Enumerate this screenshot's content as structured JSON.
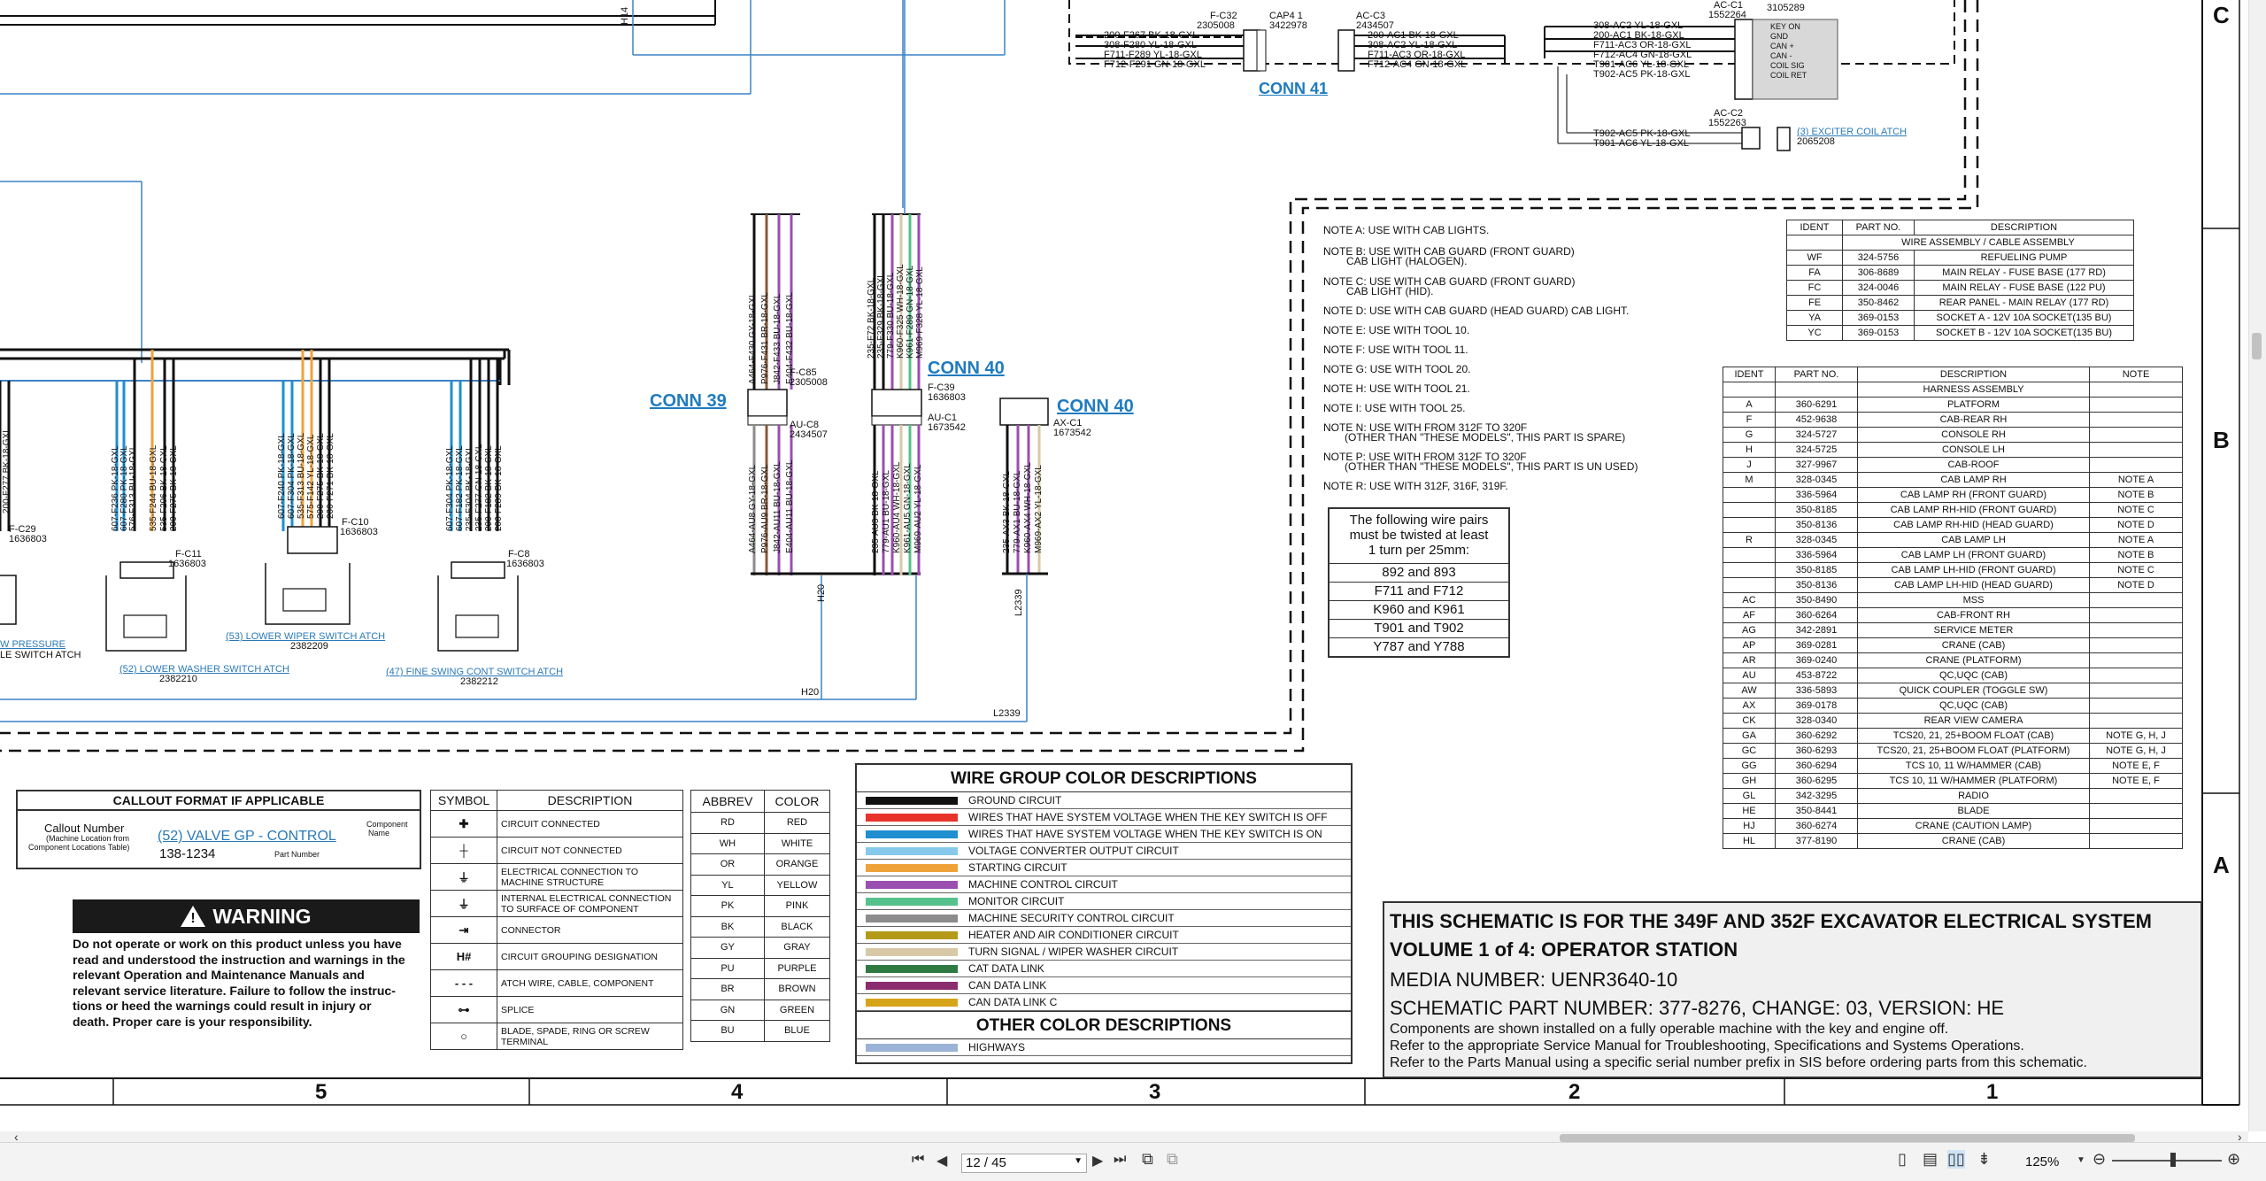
{
  "schematic": {
    "zone_labels": {
      "c": "C",
      "b": "B",
      "a": "A"
    },
    "grid_numbers": [
      "5",
      "4",
      "3",
      "2",
      "1"
    ],
    "top_connectors": {
      "fc32": {
        "ref": "F-C32",
        "part": "2305008",
        "wires": [
          "200-F267 BK-18-GXL",
          "308-F280 YL-18-GXL",
          "F711-F289 YL-18-GXL",
          "F712-F291 GN-18-GXL"
        ]
      },
      "cap41": {
        "ref": "CAP4 1",
        "part": "3422978"
      },
      "acc3": {
        "ref": "AC-C3",
        "part": "2434507",
        "wires": [
          "200-AC1 BK-18-GXL",
          "308-AC2 YL-18-GXL",
          "F711-AC3 OR-18-GXL",
          "F712-AC4 GN-18-GXL"
        ]
      },
      "acc1": {
        "ref": "AC-C1",
        "part": "1552264",
        "part2": "3105289",
        "wires": [
          "308-AC2 YL-18-GXL",
          "200-AC1 BK-18-GXL",
          "F711-AC3 OR-18-GXL",
          "F712-AC4 GN-18-GXL",
          "T901-AC6 YL-18-GXL",
          "T902-AC5 PK-18-GXL"
        ],
        "pins": [
          "KEY ON",
          "GND",
          "CAN +",
          "CAN -",
          "COIL SIG",
          "COIL RET"
        ]
      },
      "acc2": {
        "ref": "AC-C2",
        "part": "1552263",
        "wires": [
          "T902-AC5 PK-18-GXL",
          "T901-AC6 YL-18-GXL"
        ],
        "link": "(3) EXCITER COIL ATCH",
        "link_part": "2065208"
      },
      "conn41": "CONN 41",
      "h14": "H14"
    },
    "mid_connectors": {
      "conn39": "CONN 39",
      "conn40a": "CONN 40",
      "conn40b": "CONN 40",
      "fc85": {
        "ref": "F-C85",
        "part": "2305008"
      },
      "auc8": {
        "ref": "AU-C8",
        "part": "2434507"
      },
      "fc39": {
        "ref": "F-C39",
        "part": "1636803"
      },
      "auc1": {
        "ref": "AU-C1",
        "part": "1673542"
      },
      "axc1": {
        "ref": "AX-C1",
        "part": "1673542"
      },
      "h20a": "H20",
      "h20b": "H20",
      "l2339a": "L2339",
      "l2339b": "L2339",
      "c39_top_wires": [
        "A464-F430 GY-18-GXL",
        "P976-F431 BR-18-GXL",
        "J842-F433 BU-18-GXL",
        "E404-F432 BU-18-GXL"
      ],
      "c39_bot_wires": [
        "A464-AU8 GY-18-GXL",
        "P976-AU9 BR-18-GXL",
        "J842-AU11 BU-18-GXL",
        "E404-AU11 BU-18-GXL"
      ],
      "c40_top_wires": [
        "235-F72 BK-18-GXL",
        "235-F329 BK-18-GXL",
        "779-F330 BU-18-GXL",
        "K960-F325 WH-18-GXL",
        "K961-F289 GN-18-GXL",
        "M969-F328 YL-18-GXL"
      ],
      "c40_bot_wires": [
        "235-AU3 BK-18-GXL",
        "779-AU1 BU-18-GXL",
        "K960-AU4 WH-18-GXL",
        "K961-AU5 GN-18-GXL",
        "M969-AU2 YL-18-GXL"
      ],
      "c40b_wires": [
        "235-AX3 BK-18-GXL",
        "779-AX1 BU-18-GXL",
        "K960-AX4 WH-18-GXL",
        "M969-AX2 YL-18-GXL"
      ]
    },
    "left_switches": {
      "fc29": {
        "ref": "F-C29",
        "part": "1636803"
      },
      "fc11": {
        "ref": "F-C11",
        "part": "1636803"
      },
      "fc10": {
        "ref": "F-C10",
        "part": "1636803"
      },
      "fc8": {
        "ref": "F-C8",
        "part": "1636803"
      },
      "sw_pressure": "W PRESSURE",
      "sw_pressure2": "LE SWITCH ATCH",
      "sw52": {
        "label": "(52) LOWER WASHER SWITCH ATCH",
        "part": "2382210"
      },
      "sw53": {
        "label": "(53) LOWER WIPER SWITCH ATCH",
        "part": "2382209"
      },
      "sw47": {
        "label": "(47) FINE SWING CONT SWITCH ATCH",
        "part": "2382212"
      },
      "w29": "200-F277 BK-18-GXL",
      "g11": [
        "607-F236 PK-18-GXL",
        "607-F280 PK-18-GXL",
        "576-F313 BU-18-GXL",
        "535-F244 BU-18-GXL",
        "535-F296 BK-18-GXL",
        "200-F275 BK-18-GXL"
      ],
      "g10": [
        "607-F240 PK-18-GXL",
        "607-F304 PK-18-GXL",
        "535-F313 BU-18-GXL",
        "575-F142 YL-18-GXL",
        "200-F275 BK-18-GXL",
        "200-F271 BK-18-GXL"
      ],
      "g8": [
        "607-F304 PK-18-GXL",
        "607-F182 PK-18-GXL",
        "235-F304 BK-18-GXL",
        "235-F277 GN-18-GXL",
        "200-F182 BK-18-GXL",
        "200-F289 BK-18-GXL"
      ]
    },
    "notes": [
      "NOTE A: USE WITH CAB LIGHTS.",
      "NOTE B: USE WITH CAB GUARD (FRONT GUARD)",
      "CAB LIGHT (HALOGEN).",
      "NOTE C: USE WITH CAB GUARD (FRONT GUARD)",
      "CAB LIGHT (HID).",
      "NOTE D: USE WITH CAB GUARD (HEAD GUARD) CAB LIGHT.",
      "NOTE E: USE WITH TOOL 10.",
      "NOTE F: USE WITH TOOL 11.",
      "NOTE G: USE WITH TOOL 20.",
      "NOTE H: USE WITH TOOL 21.",
      "NOTE I: USE WITH TOOL 25.",
      "NOTE N: USE WITH FROM 312F TO 320F",
      "(OTHER THAN \"THESE MODELS\", THIS PART IS SPARE)",
      "NOTE P: USE WITH FROM 312F TO 320F",
      "(OTHER THAN \"THESE MODELS\", THIS PART IS UN USED)",
      "NOTE R: USE WITH 312F, 316F, 319F."
    ],
    "twisted": {
      "title": [
        "The following wire pairs",
        "must be twisted at least",
        "1 turn per 25mm:"
      ],
      "pairs": [
        "892 and 893",
        "F711 and F712",
        "K960 and K961",
        "T901 and T902",
        "Y787 and Y788"
      ]
    },
    "wire_assembly": {
      "headers": [
        "IDENT",
        "PART NO.",
        "DESCRIPTION"
      ],
      "subheader": "WIRE ASSEMBLY / CABLE ASSEMBLY",
      "rows": [
        [
          "WF",
          "324-5756",
          "REFUELING PUMP"
        ],
        [
          "FA",
          "306-8689",
          "MAIN RELAY - FUSE BASE (177 RD)"
        ],
        [
          "FC",
          "324-0046",
          "MAIN RELAY - FUSE BASE (122 PU)"
        ],
        [
          "FE",
          "350-8462",
          "REAR PANEL - MAIN RELAY (177 RD)"
        ],
        [
          "YA",
          "369-0153",
          "SOCKET A - 12V 10A SOCKET(135 BU)"
        ],
        [
          "YC",
          "369-0153",
          "SOCKET B - 12V 10A SOCKET(135 BU)"
        ]
      ]
    },
    "harness": {
      "headers": [
        "IDENT",
        "PART NO.",
        "DESCRIPTION",
        "NOTE"
      ],
      "subheader": "HARNESS ASSEMBLY",
      "rows": [
        [
          "A",
          "360-6291",
          "PLATFORM",
          ""
        ],
        [
          "F",
          "452-9638",
          "CAB-REAR RH",
          ""
        ],
        [
          "G",
          "324-5727",
          "CONSOLE RH",
          ""
        ],
        [
          "H",
          "324-5725",
          "CONSOLE LH",
          ""
        ],
        [
          "J",
          "327-9967",
          "CAB-ROOF",
          ""
        ],
        [
          "M",
          "328-0345",
          "CAB LAMP RH",
          "NOTE A"
        ],
        [
          "",
          "336-5964",
          "CAB LAMP RH (FRONT GUARD)",
          "NOTE B"
        ],
        [
          "",
          "350-8185",
          "CAB LAMP RH-HID (FRONT GUARD)",
          "NOTE C"
        ],
        [
          "",
          "350-8136",
          "CAB LAMP RH-HID (HEAD GUARD)",
          "NOTE D"
        ],
        [
          "R",
          "328-0345",
          "CAB LAMP LH",
          "NOTE A"
        ],
        [
          "",
          "336-5964",
          "CAB LAMP LH (FRONT GUARD)",
          "NOTE B"
        ],
        [
          "",
          "350-8185",
          "CAB LAMP LH-HID (FRONT GUARD)",
          "NOTE C"
        ],
        [
          "",
          "350-8136",
          "CAB LAMP LH-HID (HEAD GUARD)",
          "NOTE D"
        ],
        [
          "AC",
          "350-8490",
          "MSS",
          ""
        ],
        [
          "AF",
          "360-6264",
          "CAB-FRONT RH",
          ""
        ],
        [
          "AG",
          "342-2891",
          "SERVICE METER",
          ""
        ],
        [
          "AP",
          "369-0281",
          "CRANE (CAB)",
          ""
        ],
        [
          "AR",
          "369-0240",
          "CRANE (PLATFORM)",
          ""
        ],
        [
          "AU",
          "453-8722",
          "QC,UQC (CAB)",
          ""
        ],
        [
          "AW",
          "336-5893",
          "QUICK COUPLER (TOGGLE SW)",
          ""
        ],
        [
          "AX",
          "369-0178",
          "QC,UQC (CAB)",
          ""
        ],
        [
          "CK",
          "328-0340",
          "REAR VIEW CAMERA",
          ""
        ],
        [
          "GA",
          "360-6292",
          "TCS20, 21, 25+BOOM FLOAT (CAB)",
          "NOTE G, H, J"
        ],
        [
          "GC",
          "360-6293",
          "TCS20, 21, 25+BOOM FLOAT (PLATFORM)",
          "NOTE G, H, J"
        ],
        [
          "GG",
          "360-6294",
          "TCS 10, 11 W/HAMMER (CAB)",
          "NOTE E, F"
        ],
        [
          "GH",
          "360-6295",
          "TCS 10, 11 W/HAMMER (PLATFORM)",
          "NOTE E, F"
        ],
        [
          "GL",
          "342-3295",
          "RADIO",
          ""
        ],
        [
          "HE",
          "350-8441",
          "BLADE",
          ""
        ],
        [
          "HJ",
          "360-6274",
          "CRANE (CAUTION LAMP)",
          ""
        ],
        [
          "HL",
          "377-8190",
          "CRANE (CAB)",
          ""
        ]
      ]
    },
    "callout": {
      "title": "CALLOUT FORMAT IF APPLICABLE",
      "callout_number": "Callout Number",
      "machine_location": "(Machine Location from",
      "component_locations": "Component Locations Table)",
      "link": "(52) VALVE GP - CONTROL",
      "component_name": "Component",
      "component_name2": "Name",
      "part_number": "138-1234",
      "part_number_label": "Part Number"
    },
    "warning": {
      "title": "WARNING",
      "lines": [
        "Do not operate or work on this product unless you have",
        "read and understood the instruction and warnings in the",
        "relevant Operation and Maintenance Manuals and",
        "relevant service literature. Failure to follow the instruc-",
        "tions or heed the warnings could result in injury or",
        "death. Proper care is your responsibility."
      ]
    },
    "symbols": {
      "headers": [
        "SYMBOL",
        "DESCRIPTION"
      ],
      "rows": [
        [
          "",
          "CIRCUIT CONNECTED"
        ],
        [
          "",
          "CIRCUIT NOT CONNECTED"
        ],
        [
          "",
          "ELECTRICAL CONNECTION TO MACHINE STRUCTURE"
        ],
        [
          "",
          "INTERNAL ELECTRICAL CONNECTION TO SURFACE OF COMPONENT"
        ],
        [
          "",
          "CONNECTOR"
        ],
        [
          "H#",
          "CIRCUIT GROUPING DESIGNATION"
        ],
        [
          "",
          "ATCH WIRE, CABLE, COMPONENT"
        ],
        [
          "",
          "SPLICE"
        ],
        [
          "",
          "BLADE, SPADE, RING OR SCREW TERMINAL"
        ]
      ]
    },
    "abbrev": {
      "headers": [
        "ABBREV",
        "COLOR"
      ],
      "rows": [
        [
          "RD",
          "RED"
        ],
        [
          "WH",
          "WHITE"
        ],
        [
          "OR",
          "ORANGE"
        ],
        [
          "YL",
          "YELLOW"
        ],
        [
          "PK",
          "PINK"
        ],
        [
          "BK",
          "BLACK"
        ],
        [
          "GY",
          "GRAY"
        ],
        [
          "PU",
          "PURPLE"
        ],
        [
          "BR",
          "BROWN"
        ],
        [
          "GN",
          "GREEN"
        ],
        [
          "BU",
          "BLUE"
        ]
      ]
    },
    "wire_groups": {
      "title": "WIRE GROUP COLOR DESCRIPTIONS",
      "rows": [
        {
          "color": "#111111",
          "label": "GROUND CIRCUIT"
        },
        {
          "color": "#e8332a",
          "label": "WIRES THAT HAVE SYSTEM VOLTAGE WHEN THE KEY SWITCH IS OFF"
        },
        {
          "color": "#1f8fd0",
          "label": "WIRES THAT HAVE SYSTEM VOLTAGE WHEN THE KEY SWITCH IS ON"
        },
        {
          "color": "#86c9ea",
          "label": "VOLTAGE CONVERTER OUTPUT CIRCUIT"
        },
        {
          "color": "#f0a23a",
          "label": "STARTING CIRCUIT"
        },
        {
          "color": "#9a4fb0",
          "label": "MACHINE CONTROL CIRCUIT"
        },
        {
          "color": "#56c28b",
          "label": "MONITOR CIRCUIT"
        },
        {
          "color": "#8c8c8c",
          "label": "MACHINE SECURITY CONTROL CIRCUIT"
        },
        {
          "color": "#b49a18",
          "label": "HEATER AND AIR CONDITIONER CIRCUIT"
        },
        {
          "color": "#d8c9a6",
          "label": "TURN SIGNAL / WIPER WASHER CIRCUIT"
        },
        {
          "color": "#2f7a43",
          "label": "CAT DATA LINK"
        },
        {
          "color": "#8a2c6e",
          "label": "CAN DATA LINK"
        },
        {
          "color": "#d6a418",
          "label": "CAN DATA LINK C"
        }
      ],
      "other_title": "OTHER COLOR DESCRIPTIONS",
      "other_rows": [
        {
          "color": "#9ab3d6",
          "label": "HIGHWAYS"
        }
      ]
    },
    "title_block": {
      "line1": "THIS SCHEMATIC IS FOR THE 349F AND 352F EXCAVATOR ELECTRICAL SYSTEM",
      "line2": "VOLUME 1 of 4: OPERATOR STATION",
      "media": "MEDIA NUMBER: UENR3640-10",
      "part": "SCHEMATIC PART NUMBER: 377-8276, CHANGE: 03, VERSION: HE",
      "info1": "Components are shown installed on a fully operable machine with the key and engine off.",
      "info2": "Refer to the appropriate Service Manual for Troubleshooting, Specifications and Systems Operations.",
      "info3": "Refer to the Parts Manual using a specific serial number prefix in SIS before ordering parts from this schematic."
    }
  },
  "viewer": {
    "page_value": "12 / 45",
    "zoom": "125%"
  }
}
